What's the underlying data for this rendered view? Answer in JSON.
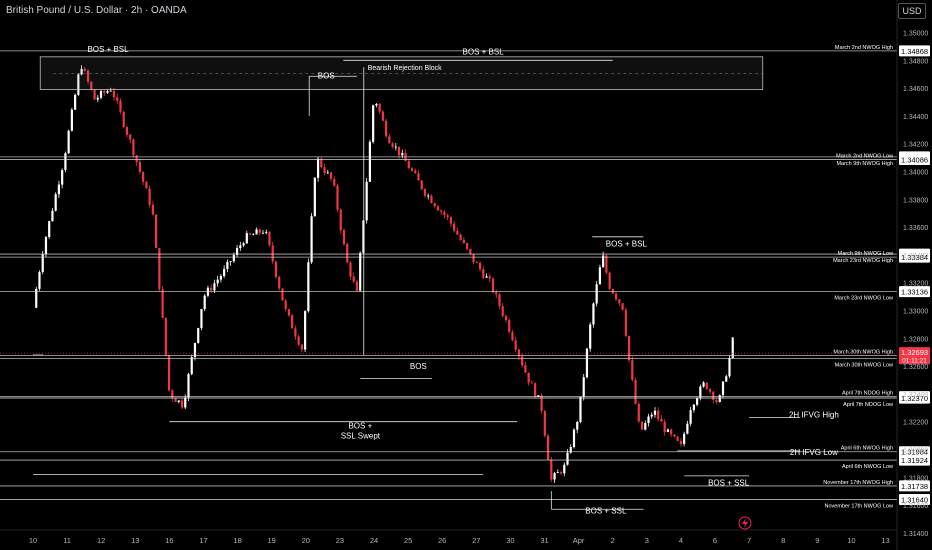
{
  "header": {
    "symbol_title": "British Pound / U.S. Dollar · 2h · OANDA",
    "currency": "USD"
  },
  "colors": {
    "background": "#000000",
    "up": "#ffffff",
    "down": "#f23645",
    "level_line": "#d9d9d9",
    "current_price_bg": "#f23645",
    "watermark": "#e91e63"
  },
  "icons": {
    "watermark": "lightning-bolt-icon"
  },
  "chart_data": {
    "type": "candlestick",
    "instrument": "GBP/USD",
    "interval": "2h",
    "ylim": [
      1.313,
      1.351
    ],
    "y_ticks": [
      "1.35000",
      "1.34800",
      "1.34600",
      "1.34400",
      "1.34200",
      "1.34000",
      "1.33800",
      "1.33600",
      "1.33400",
      "1.33200",
      "1.33000",
      "1.32800",
      "1.32600",
      "1.32400",
      "1.32200",
      "1.32000",
      "1.31800",
      "1.31600",
      "1.31400"
    ],
    "x_ticks": [
      "10",
      "11",
      "12",
      "13",
      "16",
      "17",
      "18",
      "19",
      "20",
      "23",
      "24",
      "25",
      "26",
      "27",
      "30",
      "31",
      "Apr",
      "2",
      "3",
      "4",
      "6",
      "7",
      "8",
      "9",
      "10",
      "13"
    ],
    "close_path": [
      {
        "x": 0,
        "y": 1.3302
      },
      {
        "x": 0.3,
        "y": 1.3345
      },
      {
        "x": 0.9,
        "y": 1.3408
      },
      {
        "x": 1.4,
        "y": 1.3478
      },
      {
        "x": 1.8,
        "y": 1.3452
      },
      {
        "x": 2.3,
        "y": 1.346
      },
      {
        "x": 2.9,
        "y": 1.3418
      },
      {
        "x": 3.5,
        "y": 1.3372
      },
      {
        "x": 4.0,
        "y": 1.324
      },
      {
        "x": 4.4,
        "y": 1.3232
      },
      {
        "x": 5.0,
        "y": 1.331
      },
      {
        "x": 5.6,
        "y": 1.3328
      },
      {
        "x": 6.2,
        "y": 1.3352
      },
      {
        "x": 6.8,
        "y": 1.3358
      },
      {
        "x": 7.4,
        "y": 1.33
      },
      {
        "x": 7.9,
        "y": 1.3272
      },
      {
        "x": 8.3,
        "y": 1.341
      },
      {
        "x": 8.8,
        "y": 1.3392
      },
      {
        "x": 9.2,
        "y": 1.3335
      },
      {
        "x": 9.5,
        "y": 1.3312
      },
      {
        "x": 10.0,
        "y": 1.3455
      },
      {
        "x": 10.4,
        "y": 1.3425
      },
      {
        "x": 10.9,
        "y": 1.3408
      },
      {
        "x": 11.5,
        "y": 1.3385
      },
      {
        "x": 12.2,
        "y": 1.3365
      },
      {
        "x": 12.8,
        "y": 1.334
      },
      {
        "x": 13.4,
        "y": 1.332
      },
      {
        "x": 14.0,
        "y": 1.3285
      },
      {
        "x": 14.5,
        "y": 1.3252
      },
      {
        "x": 14.9,
        "y": 1.3232
      },
      {
        "x": 15.2,
        "y": 1.3178
      },
      {
        "x": 15.6,
        "y": 1.3188
      },
      {
        "x": 16.0,
        "y": 1.3225
      },
      {
        "x": 16.4,
        "y": 1.33
      },
      {
        "x": 16.7,
        "y": 1.334
      },
      {
        "x": 16.9,
        "y": 1.3318
      },
      {
        "x": 17.3,
        "y": 1.3302
      },
      {
        "x": 17.5,
        "y": 1.326
      },
      {
        "x": 17.8,
        "y": 1.3212
      },
      {
        "x": 18.2,
        "y": 1.3228
      },
      {
        "x": 18.6,
        "y": 1.3212
      },
      {
        "x": 19.0,
        "y": 1.3202
      },
      {
        "x": 19.3,
        "y": 1.3232
      },
      {
        "x": 19.7,
        "y": 1.3248
      },
      {
        "x": 20.1,
        "y": 1.3233
      },
      {
        "x": 20.4,
        "y": 1.3262
      },
      {
        "x": 20.55,
        "y": 1.3282
      }
    ],
    "current_price": "1.32693",
    "countdown": "01:11:21",
    "levels": [
      {
        "name": "March 2nd NWOG High",
        "price": "1.34868"
      },
      {
        "name": "March 9th NWOG High",
        "price": "1.34105"
      },
      {
        "name": "March 2nd NWOG Low",
        "price": "1.34086"
      },
      {
        "name": "March 23rd NWOG High",
        "price": "1.33406"
      },
      {
        "name": "March 9th NWOG Low",
        "price": "1.33384"
      },
      {
        "name": "March 23rd NWOG Low",
        "price": "1.33136"
      },
      {
        "name": "March 30th NWOG High",
        "price": "1.32677"
      },
      {
        "name": "March 30th NWOG Low",
        "price": "1.32654"
      },
      {
        "name": "April 7th NDOG High",
        "price": "1.32380"
      },
      {
        "name": "April 7th NDOG Low",
        "price": "1.32370"
      },
      {
        "name": "April 6th NWOG High",
        "price": "1.31984"
      },
      {
        "name": "April 6th NWOG Low",
        "price": "1.31924"
      },
      {
        "name": "November 17th NWOG High",
        "price": "1.31738"
      },
      {
        "name": "November 17th NWOG Low",
        "price": "1.31640"
      }
    ],
    "structure_labels": [
      {
        "text": "BOS + BSL",
        "price": 1.3486,
        "x": 2.2
      },
      {
        "text": "BOS + BSL",
        "price": 1.3484,
        "x": 13.2
      },
      {
        "text": "BOS",
        "price": 1.3467,
        "x": 8.6
      },
      {
        "text": "Bearish Rejection Block",
        "price": 1.3473,
        "x": 10.9
      },
      {
        "text": "BOS + BSL",
        "price": 1.3346,
        "x": 17.4
      },
      {
        "text": "BOS",
        "price": 1.3258,
        "x": 11.3
      },
      {
        "text": "BOS +",
        "price": 1.3215,
        "x": 9.6
      },
      {
        "text": "SSL Swept",
        "price": 1.3208,
        "x": 9.6
      },
      {
        "text": "2H IFVG High",
        "price": 1.3223,
        "x": 22.9
      },
      {
        "text": "2H IFVG Low",
        "price": 1.3196,
        "x": 22.9
      },
      {
        "text": "BOS + SSL",
        "price": 1.3174,
        "x": 20.4
      },
      {
        "text": "BOS + SSL",
        "price": 1.3154,
        "x": 16.8
      }
    ],
    "rejection_block": {
      "price_top": 1.34825,
      "price_bottom": 1.3459,
      "x_from": 0.3,
      "x_to": 21.4
    }
  }
}
